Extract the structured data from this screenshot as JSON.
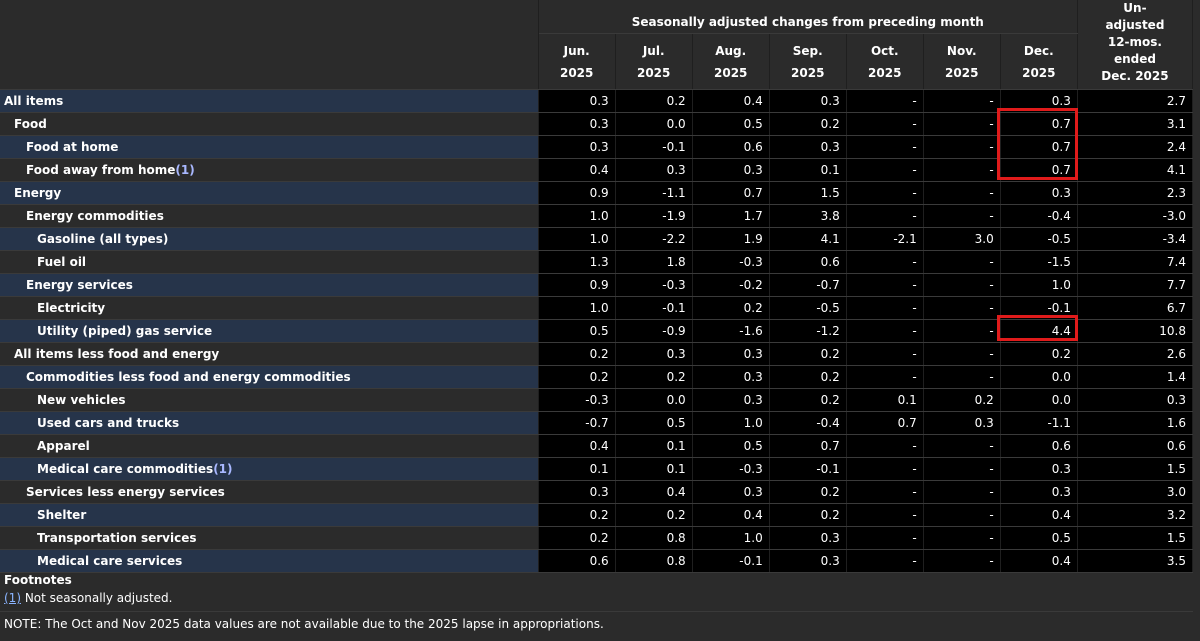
{
  "header": {
    "span_title": "Seasonally adjusted changes from preceding month",
    "months": [
      {
        "m": "Jun.",
        "y": "2025"
      },
      {
        "m": "Jul.",
        "y": "2025"
      },
      {
        "m": "Aug.",
        "y": "2025"
      },
      {
        "m": "Sep.",
        "y": "2025"
      },
      {
        "m": "Oct.",
        "y": "2025"
      },
      {
        "m": "Nov.",
        "y": "2025"
      },
      {
        "m": "Dec.",
        "y": "2025"
      }
    ],
    "unadjusted": [
      "Un-",
      "adjusted",
      "12-mos.",
      "ended",
      "Dec. 2025"
    ]
  },
  "rows": [
    {
      "label": "All items",
      "fn": "",
      "level": 0,
      "values": [
        "0.3",
        "0.2",
        "0.4",
        "0.3",
        "-",
        "-",
        "0.3",
        "2.7"
      ]
    },
    {
      "label": "Food",
      "fn": "",
      "level": 1,
      "values": [
        "0.3",
        "0.0",
        "0.5",
        "0.2",
        "-",
        "-",
        "0.7",
        "3.1"
      ]
    },
    {
      "label": "Food at home",
      "fn": "",
      "level": 2,
      "values": [
        "0.3",
        "-0.1",
        "0.6",
        "0.3",
        "-",
        "-",
        "0.7",
        "2.4"
      ]
    },
    {
      "label": "Food away from home",
      "fn": "(1)",
      "level": 2,
      "values": [
        "0.4",
        "0.3",
        "0.3",
        "0.1",
        "-",
        "-",
        "0.7",
        "4.1"
      ]
    },
    {
      "label": "Energy",
      "fn": "",
      "level": 1,
      "values": [
        "0.9",
        "-1.1",
        "0.7",
        "1.5",
        "-",
        "-",
        "0.3",
        "2.3"
      ]
    },
    {
      "label": "Energy commodities",
      "fn": "",
      "level": 2,
      "values": [
        "1.0",
        "-1.9",
        "1.7",
        "3.8",
        "-",
        "-",
        "-0.4",
        "-3.0"
      ]
    },
    {
      "label": "Gasoline (all types)",
      "fn": "",
      "level": 3,
      "values": [
        "1.0",
        "-2.2",
        "1.9",
        "4.1",
        "-2.1",
        "3.0",
        "-0.5",
        "-3.4"
      ]
    },
    {
      "label": "Fuel oil",
      "fn": "",
      "level": 3,
      "values": [
        "1.3",
        "1.8",
        "-0.3",
        "0.6",
        "-",
        "-",
        "-1.5",
        "7.4"
      ]
    },
    {
      "label": "Energy services",
      "fn": "",
      "level": 2,
      "values": [
        "0.9",
        "-0.3",
        "-0.2",
        "-0.7",
        "-",
        "-",
        "1.0",
        "7.7"
      ]
    },
    {
      "label": "Electricity",
      "fn": "",
      "level": 3,
      "values": [
        "1.0",
        "-0.1",
        "0.2",
        "-0.5",
        "-",
        "-",
        "-0.1",
        "6.7"
      ]
    },
    {
      "label": "Utility (piped) gas service",
      "fn": "",
      "level": 3,
      "values": [
        "0.5",
        "-0.9",
        "-1.6",
        "-1.2",
        "-",
        "-",
        "4.4",
        "10.8"
      ]
    },
    {
      "label": "All items less food and energy",
      "fn": "",
      "level": 1,
      "values": [
        "0.2",
        "0.3",
        "0.3",
        "0.2",
        "-",
        "-",
        "0.2",
        "2.6"
      ]
    },
    {
      "label": "Commodities less food and energy commodities",
      "fn": "",
      "level": 2,
      "values": [
        "0.2",
        "0.2",
        "0.3",
        "0.2",
        "-",
        "-",
        "0.0",
        "1.4"
      ]
    },
    {
      "label": "New vehicles",
      "fn": "",
      "level": 3,
      "values": [
        "-0.3",
        "0.0",
        "0.3",
        "0.2",
        "0.1",
        "0.2",
        "0.0",
        "0.3"
      ]
    },
    {
      "label": "Used cars and trucks",
      "fn": "",
      "level": 3,
      "values": [
        "-0.7",
        "0.5",
        "1.0",
        "-0.4",
        "0.7",
        "0.3",
        "-1.1",
        "1.6"
      ]
    },
    {
      "label": "Apparel",
      "fn": "",
      "level": 3,
      "values": [
        "0.4",
        "0.1",
        "0.5",
        "0.7",
        "-",
        "-",
        "0.6",
        "0.6"
      ]
    },
    {
      "label": "Medical care commodities",
      "fn": "(1)",
      "level": 3,
      "values": [
        "0.1",
        "0.1",
        "-0.3",
        "-0.1",
        "-",
        "-",
        "0.3",
        "1.5"
      ]
    },
    {
      "label": "Services less energy services",
      "fn": "",
      "level": 2,
      "values": [
        "0.3",
        "0.4",
        "0.3",
        "0.2",
        "-",
        "-",
        "0.3",
        "3.0"
      ]
    },
    {
      "label": "Shelter",
      "fn": "",
      "level": 3,
      "values": [
        "0.2",
        "0.2",
        "0.4",
        "0.2",
        "-",
        "-",
        "0.4",
        "3.2"
      ]
    },
    {
      "label": "Transportation services",
      "fn": "",
      "level": 3,
      "values": [
        "0.2",
        "0.8",
        "1.0",
        "0.3",
        "-",
        "-",
        "0.5",
        "1.5"
      ]
    },
    {
      "label": "Medical care services",
      "fn": "",
      "level": 3,
      "values": [
        "0.6",
        "0.8",
        "-0.1",
        "0.3",
        "-",
        "-",
        "0.4",
        "3.5"
      ]
    }
  ],
  "footnotes": {
    "title": "Footnotes",
    "items": [
      {
        "ref": "(1)",
        "text": " Not seasonally adjusted."
      }
    ],
    "note": "NOTE: The Oct and Nov 2025 data values are not available due to the 2025 lapse in appropriations."
  },
  "colors": {
    "page_bg": "#2b2b2b",
    "label_band": "#26344a",
    "value_bg": "#000000",
    "highlight_box": "#e01b1b",
    "footnote_link": "#8ab4ff"
  }
}
